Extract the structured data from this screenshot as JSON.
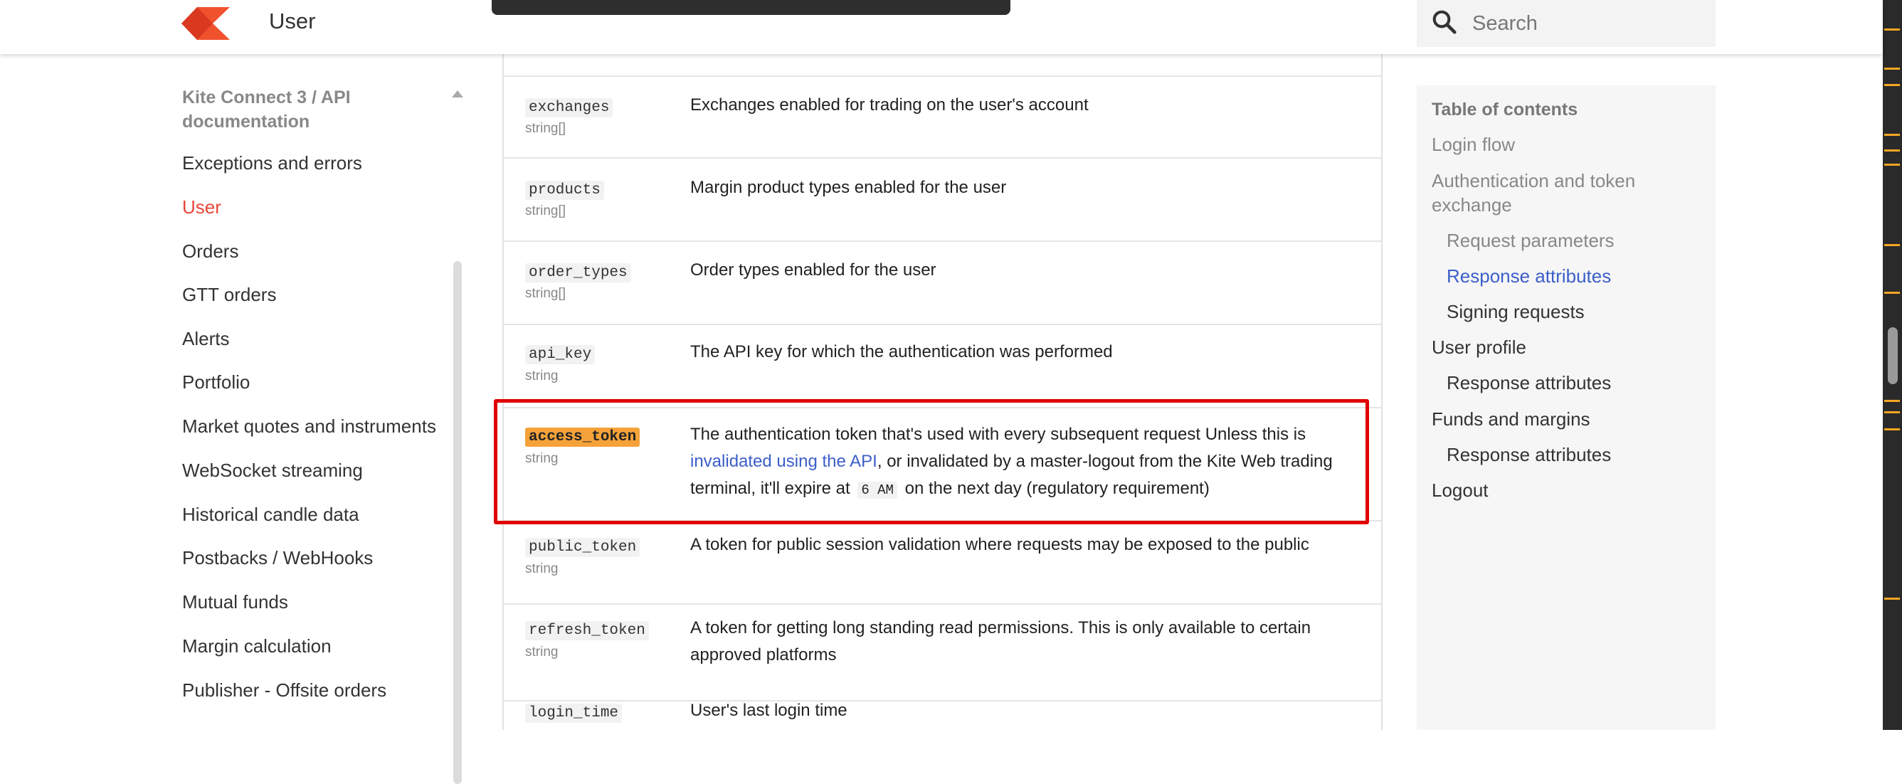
{
  "header": {
    "page_title": "User",
    "search_placeholder": "Search"
  },
  "sidebar": {
    "section_title": "Kite Connect 3 / API documentation",
    "items": [
      {
        "label": "Exceptions and errors"
      },
      {
        "label": "User"
      },
      {
        "label": "Orders"
      },
      {
        "label": "GTT orders"
      },
      {
        "label": "Alerts"
      },
      {
        "label": "Portfolio"
      },
      {
        "label": "Market quotes and instruments"
      },
      {
        "label": "WebSocket streaming"
      },
      {
        "label": "Historical candle data"
      },
      {
        "label": "Postbacks / WebHooks"
      },
      {
        "label": "Mutual funds"
      },
      {
        "label": "Margin calculation"
      },
      {
        "label": "Publisher - Offsite orders"
      }
    ],
    "active_item": "User"
  },
  "table": {
    "rows": [
      {
        "name": "exchanges",
        "type": "string[]",
        "desc": "Exchanges enabled for trading on the user's account"
      },
      {
        "name": "products",
        "type": "string[]",
        "desc": "Margin product types enabled for the user"
      },
      {
        "name": "order_types",
        "type": "string[]",
        "desc": "Order types enabled for the user"
      },
      {
        "name": "api_key",
        "type": "string",
        "desc": "The API key for which the authentication was performed"
      },
      {
        "name": "access_token",
        "type": "string",
        "desc_part1": "The authentication token that's used with every subsequent request Unless this is ",
        "desc_link": "invalidated using the API",
        "desc_part2": ", or invalidated by a master-logout from the Kite Web trading terminal, it'll expire at ",
        "desc_code": "6 AM",
        "desc_part3": " on the next day (regulatory requirement)"
      },
      {
        "name": "public_token",
        "type": "string",
        "desc": "A token for public session validation where requests may be exposed to the public"
      },
      {
        "name": "refresh_token",
        "type": "string",
        "desc": "A token for getting long standing read permissions. This is only available to certain approved platforms"
      },
      {
        "name": "login_time",
        "type": "",
        "desc": "User's last login time"
      }
    ]
  },
  "toc": {
    "title": "Table of contents",
    "items": [
      {
        "label": "Login flow",
        "state": "muted"
      },
      {
        "label": "Authentication and token exchange",
        "state": "muted"
      },
      {
        "label": "Request parameters",
        "state": "muted"
      },
      {
        "label": "Response attributes",
        "state": "active"
      },
      {
        "label": "Signing requests",
        "state": "normal"
      },
      {
        "label": "User profile",
        "state": "normal"
      },
      {
        "label": "Response attributes",
        "state": "normal"
      },
      {
        "label": "Funds and margins",
        "state": "normal"
      },
      {
        "label": "Response attributes",
        "state": "normal"
      },
      {
        "label": "Logout",
        "state": "normal"
      }
    ]
  },
  "colors": {
    "accent": "#e8473a",
    "link": "#3b5ec9",
    "highlight_box": "#e00000",
    "token_highlight": "#f5a23a"
  }
}
